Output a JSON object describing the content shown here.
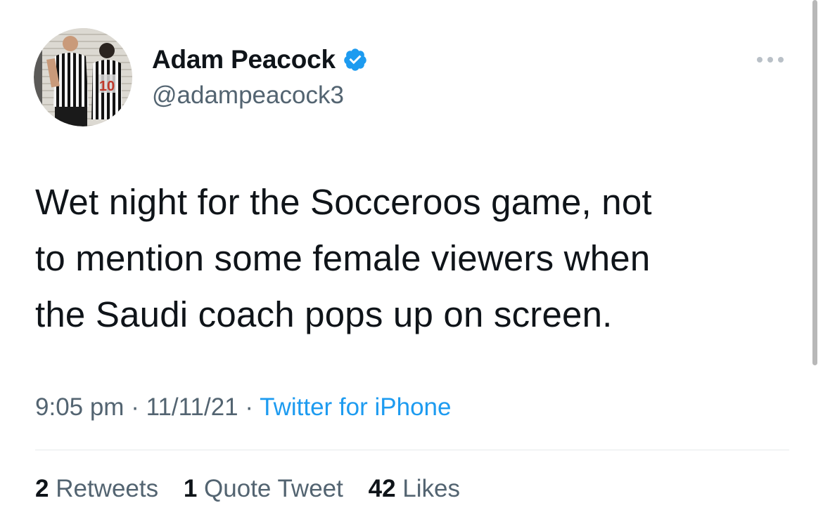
{
  "author": {
    "name": "Adam Peacock",
    "handle": "@adampeacock3",
    "verified": true,
    "avatar_jersey_number": "10"
  },
  "tweet": {
    "text_lines": [
      "Wet night for the Socceroos game, not",
      "to mention some female viewers when",
      "the Saudi coach pops up on screen."
    ]
  },
  "meta": {
    "time": "9:05 pm",
    "separator": "·",
    "date": "11/11/21",
    "source": "Twitter for iPhone"
  },
  "stats": {
    "retweets_count": "2",
    "retweets_label": "Retweets",
    "quotes_count": "1",
    "quotes_label": "Quote Tweet",
    "likes_count": "42",
    "likes_label": "Likes"
  },
  "icons": {
    "verified": "verified-badge-icon",
    "more": "more-options-icon"
  },
  "colors": {
    "text_primary": "#0f1419",
    "text_secondary": "#536471",
    "accent": "#1d9bf0",
    "divider": "#e6e9eb"
  }
}
